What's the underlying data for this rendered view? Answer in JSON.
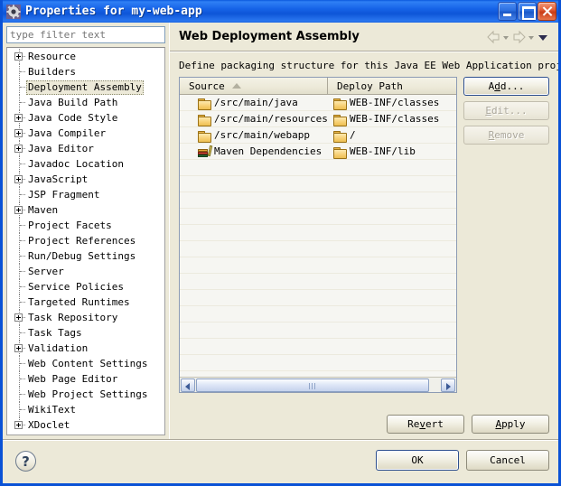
{
  "window": {
    "title": "Properties for my-web-app",
    "icon": "properties-gear-icon",
    "minimize_label": "Minimize",
    "maximize_label": "Maximize",
    "close_label": "Close"
  },
  "filter": {
    "placeholder": "type filter text",
    "value": ""
  },
  "tree": {
    "items": [
      {
        "label": "Resource",
        "expandable": true,
        "selected": false
      },
      {
        "label": "Builders",
        "expandable": false,
        "selected": false
      },
      {
        "label": "Deployment Assembly",
        "expandable": false,
        "selected": true
      },
      {
        "label": "Java Build Path",
        "expandable": false,
        "selected": false
      },
      {
        "label": "Java Code Style",
        "expandable": true,
        "selected": false
      },
      {
        "label": "Java Compiler",
        "expandable": true,
        "selected": false
      },
      {
        "label": "Java Editor",
        "expandable": true,
        "selected": false
      },
      {
        "label": "Javadoc Location",
        "expandable": false,
        "selected": false
      },
      {
        "label": "JavaScript",
        "expandable": true,
        "selected": false
      },
      {
        "label": "JSP Fragment",
        "expandable": false,
        "selected": false
      },
      {
        "label": "Maven",
        "expandable": true,
        "selected": false
      },
      {
        "label": "Project Facets",
        "expandable": false,
        "selected": false
      },
      {
        "label": "Project References",
        "expandable": false,
        "selected": false
      },
      {
        "label": "Run/Debug Settings",
        "expandable": false,
        "selected": false
      },
      {
        "label": "Server",
        "expandable": false,
        "selected": false
      },
      {
        "label": "Service Policies",
        "expandable": false,
        "selected": false
      },
      {
        "label": "Targeted Runtimes",
        "expandable": false,
        "selected": false
      },
      {
        "label": "Task Repository",
        "expandable": true,
        "selected": false
      },
      {
        "label": "Task Tags",
        "expandable": false,
        "selected": false
      },
      {
        "label": "Validation",
        "expandable": true,
        "selected": false
      },
      {
        "label": "Web Content Settings",
        "expandable": false,
        "selected": false
      },
      {
        "label": "Web Page Editor",
        "expandable": false,
        "selected": false
      },
      {
        "label": "Web Project Settings",
        "expandable": false,
        "selected": false
      },
      {
        "label": "WikiText",
        "expandable": false,
        "selected": false
      },
      {
        "label": "XDoclet",
        "expandable": true,
        "selected": false
      }
    ]
  },
  "page": {
    "title": "Web Deployment Assembly",
    "description": "Define packaging structure for this Java EE Web Application project.",
    "nav": {
      "back_icon": "arrow-left-icon",
      "back_menu_icon": "chevron-down-icon",
      "forward_icon": "arrow-right-icon",
      "forward_menu_icon": "chevron-down-icon",
      "menu_icon": "chevron-down-icon"
    }
  },
  "table": {
    "columns": [
      {
        "label": "Source",
        "sort": "ascending"
      },
      {
        "label": "Deploy Path",
        "sort": "none"
      }
    ],
    "rows": [
      {
        "icon": "folder-icon",
        "source": "/src/main/java",
        "deploy_icon": "folder-icon",
        "deploy": "WEB-INF/classes"
      },
      {
        "icon": "folder-icon",
        "source": "/src/main/resources",
        "deploy_icon": "folder-icon",
        "deploy": "WEB-INF/classes"
      },
      {
        "icon": "folder-icon",
        "source": "/src/main/webapp",
        "deploy_icon": "folder-icon",
        "deploy": "/"
      },
      {
        "icon": "books-icon",
        "source": "Maven Dependencies",
        "deploy_icon": "folder-icon",
        "deploy": "WEB-INF/lib"
      }
    ],
    "scrollbar": {
      "left_icon": "scroll-left-icon",
      "right_icon": "scroll-right-icon"
    }
  },
  "side_buttons": [
    {
      "label": "Add...",
      "mnemonic": "d",
      "state": "focused"
    },
    {
      "label": "Edit...",
      "mnemonic": "E",
      "state": "disabled"
    },
    {
      "label": "Remove",
      "mnemonic": "R",
      "state": "disabled"
    }
  ],
  "apply_buttons": [
    {
      "label": "Revert",
      "mnemonic": "v",
      "state": "normal"
    },
    {
      "label": "Apply",
      "mnemonic": "A",
      "state": "normal"
    }
  ],
  "footer": {
    "help_icon": "help-question-icon",
    "help_label": "?",
    "buttons": [
      {
        "label": "OK",
        "state": "default"
      },
      {
        "label": "Cancel",
        "state": "normal"
      }
    ]
  }
}
